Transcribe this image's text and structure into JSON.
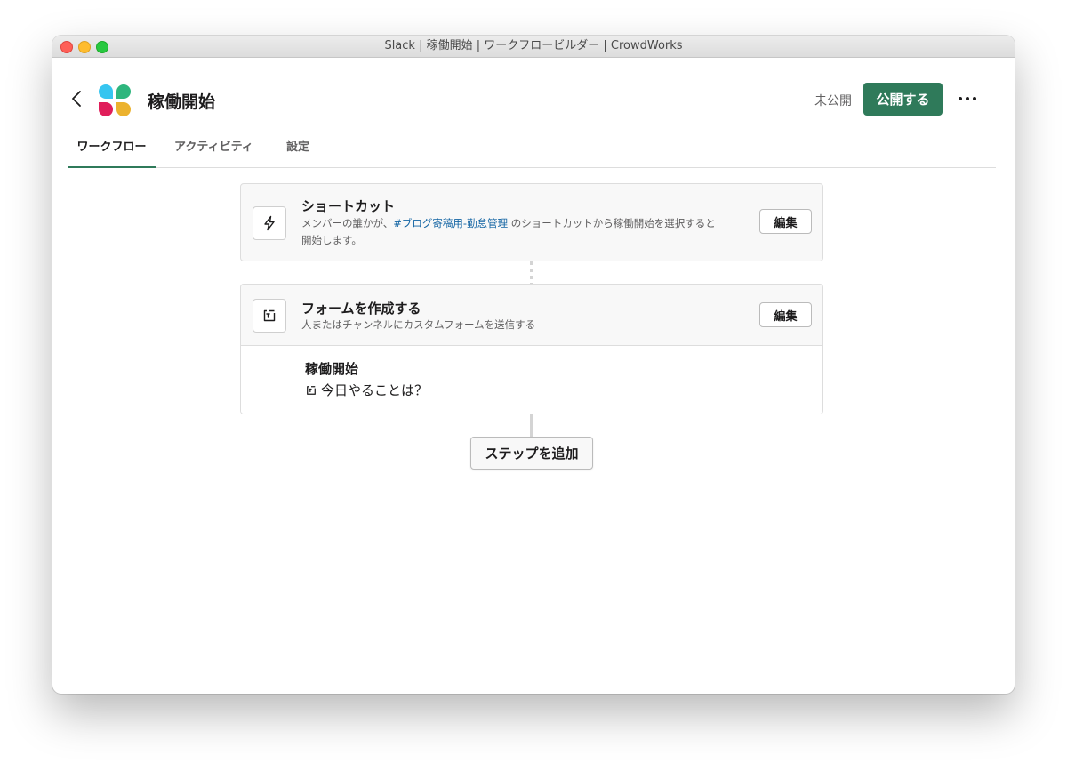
{
  "window": {
    "title": "Slack | 稼働開始 | ワークフロービルダー | CrowdWorks"
  },
  "header": {
    "title": "稼働開始",
    "status": "未公開",
    "publish_label": "公開する"
  },
  "tabs": [
    {
      "label": "ワークフロー",
      "active": true
    },
    {
      "label": "アクティビティ",
      "active": false
    },
    {
      "label": "設定",
      "active": false
    }
  ],
  "steps": [
    {
      "title": "ショートカット",
      "desc_before": "メンバーの誰かが、",
      "desc_link": "#ブログ寄稿用-勤怠管理",
      "desc_after": " のショートカットから稼働開始を選択すると",
      "desc_line2": "開始します。",
      "edit_label": "編集",
      "icon": "lightning-icon"
    },
    {
      "title": "フォームを作成する",
      "desc": "人またはチャンネルにカスタムフォームを送信する",
      "edit_label": "編集",
      "icon": "form-icon",
      "form_name": "稼働開始",
      "question": "今日やることは？"
    }
  ],
  "add_step_label": "ステップを追加",
  "colors": {
    "accent": "#2f7a5a",
    "link": "#1264a3",
    "logo": [
      "#36c5f0",
      "#2eb67d",
      "#e01e5a",
      "#ecb22e"
    ]
  }
}
